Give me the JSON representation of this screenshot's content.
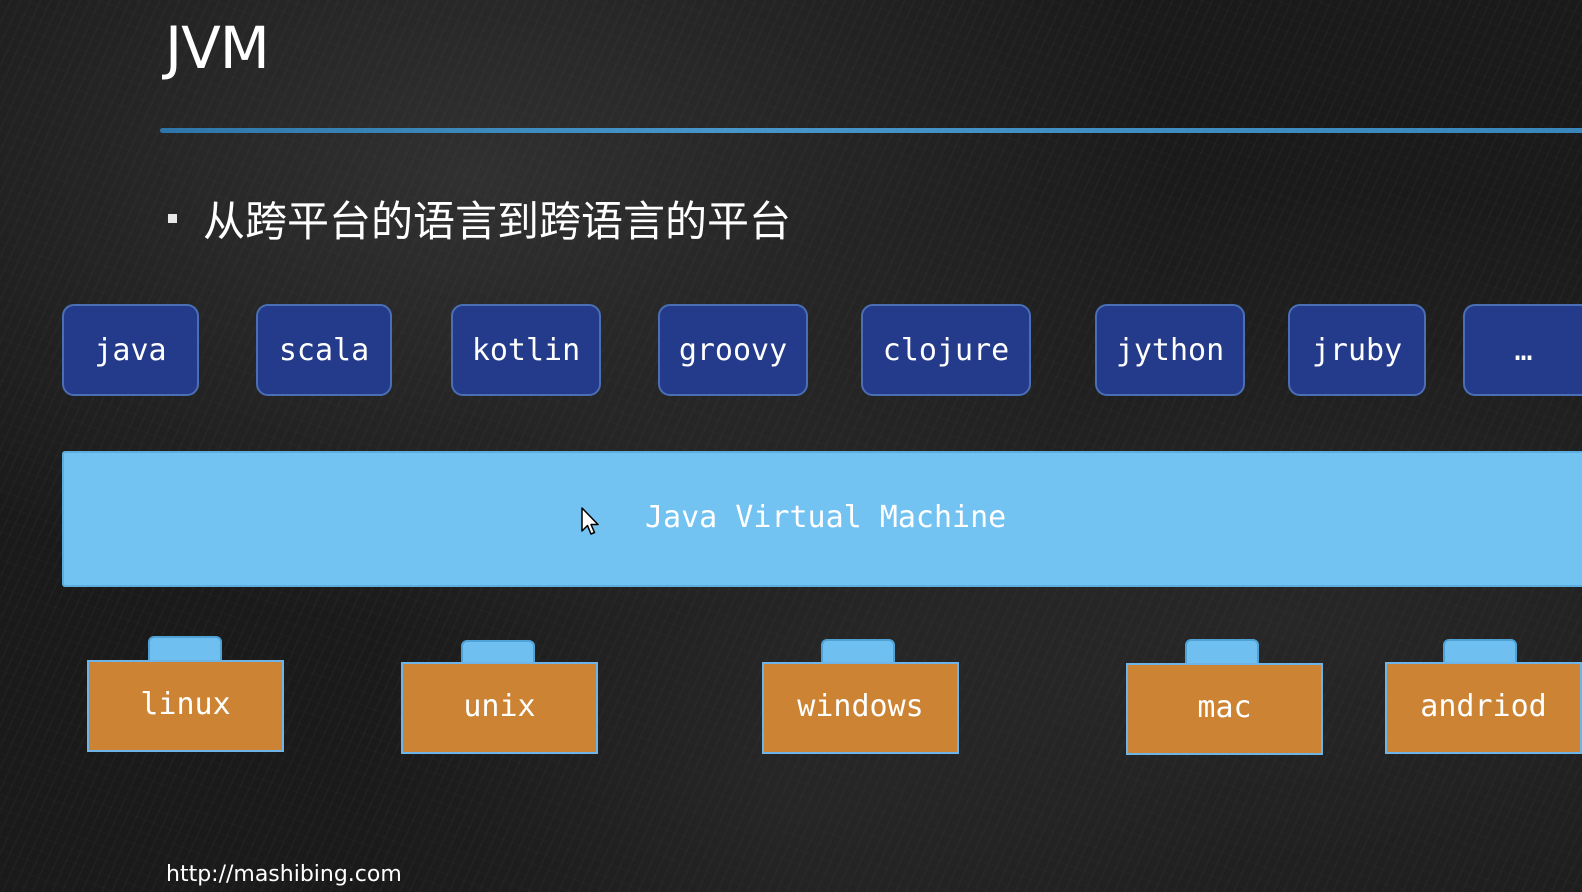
{
  "slide": {
    "title": "JVM",
    "bullet": "从跨平台的语言到跨语言的平台",
    "footer_url": "http://mashibing.com"
  },
  "languages": [
    "java",
    "scala",
    "kotlin",
    "groovy",
    "clojure",
    "jython",
    "jruby",
    "…"
  ],
  "jvm": {
    "label": "Java Virtual Machine"
  },
  "platforms": [
    "linux",
    "unix",
    "windows",
    "mac",
    "andriod"
  ],
  "colors": {
    "language_box": "#243a8a",
    "jvm_bar": "#72c2f2",
    "platform_body": "#cc8333",
    "platform_tab": "#6fbff0",
    "title_rule": "#4aa3dc"
  }
}
